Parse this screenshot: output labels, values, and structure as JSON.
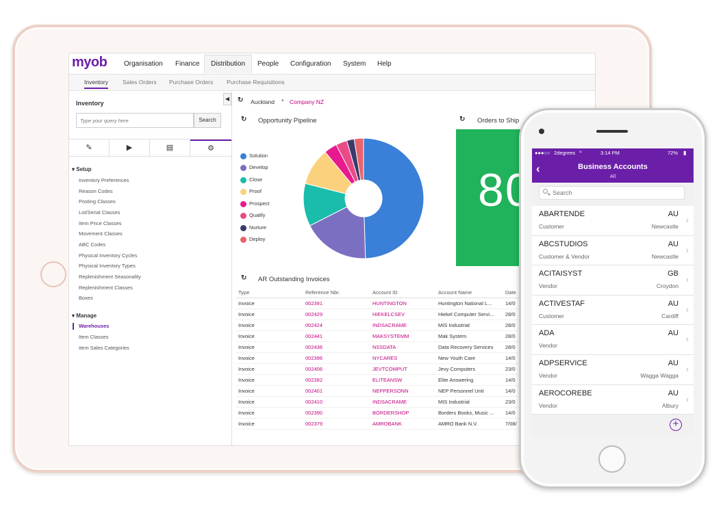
{
  "app": {
    "logo": "myob",
    "nav": [
      "Organisation",
      "Finance",
      "Distribution",
      "People",
      "Configuration",
      "System",
      "Help"
    ],
    "active_nav": "Distribution",
    "subtabs": [
      "Inventory",
      "Sales Orders",
      "Purchase Orders",
      "Purchase Requisitions"
    ],
    "active_subtab": "Inventory"
  },
  "sidebar": {
    "title": "Inventory",
    "search_placeholder": "Type your query here",
    "search_button": "Search",
    "tools": [
      "pencil-icon",
      "play-icon",
      "report-icon",
      "gear-icon"
    ],
    "setup_heading": "Setup",
    "setup_items": [
      "Inventory Preferences",
      "Reason Codes",
      "Posting Classes",
      "Lot/Serial Classes",
      "Item Price Classes",
      "Movement Classes",
      "ABC Codes",
      "Physical Inventory Cycles",
      "Physical Inventory Types",
      "Replenishment Seasonality",
      "Replenishment Classes",
      "Boxes"
    ],
    "manage_heading": "Manage",
    "manage_items": [
      "Warehouses",
      "Item Classes",
      "Item Sales Categories"
    ],
    "selected_item": "Warehouses"
  },
  "context": {
    "branch": "Auckland",
    "company": "Company NZ"
  },
  "pipeline": {
    "title": "Opportunity Pipeline",
    "legend": [
      {
        "name": "Solution",
        "color": "#3a7fd8"
      },
      {
        "name": "Develop",
        "color": "#7b6fc2"
      },
      {
        "name": "Close",
        "color": "#1abcab"
      },
      {
        "name": "Proof",
        "color": "#fcd17d"
      },
      {
        "name": "Prospect",
        "color": "#e81a8d"
      },
      {
        "name": "Qualify",
        "color": "#e94b86"
      },
      {
        "name": "Nurture",
        "color": "#3b3a6e"
      },
      {
        "name": "Deploy",
        "color": "#e8646d"
      }
    ]
  },
  "chart_data": {
    "type": "pie",
    "categories": [
      "Solution",
      "Develop",
      "Close",
      "Proof",
      "Prospect",
      "Qualify",
      "Nurture",
      "Deploy"
    ],
    "values": [
      49.5,
      18,
      11.5,
      10,
      3.5,
      3,
      2,
      2.5
    ],
    "colors": [
      "#3a7fd8",
      "#7b6fc2",
      "#1abcab",
      "#fcd17d",
      "#e81a8d",
      "#e94b86",
      "#3b3a6e",
      "#e8646d"
    ],
    "title": "Opportunity Pipeline",
    "legend_position": "left"
  },
  "orders_widget": {
    "title": "Orders to Ship",
    "value": "80"
  },
  "invoices": {
    "title": "AR Outstanding Invoices",
    "columns": [
      "Type",
      "Reference Nbr.",
      "Account ID",
      "Account Name",
      "Date"
    ],
    "rows": [
      [
        "Invoice",
        "002391",
        "HUNTINGTON",
        "Huntington National L...",
        "14/0"
      ],
      [
        "Invoice",
        "002429",
        "HIEKELCSEV",
        "Hiekel Computer Servi...",
        "28/0"
      ],
      [
        "Invoice",
        "002424",
        "INDSACRAME",
        "MIS Industrial",
        "28/0"
      ],
      [
        "Invoice",
        "002441",
        "MAKSYSTEMM",
        "Mak System",
        "28/0"
      ],
      [
        "Invoice",
        "002436",
        "NSSDATA",
        "Data Recovery Services",
        "28/0"
      ],
      [
        "Invoice",
        "002396",
        "NYCARES",
        "New Youth Care",
        "14/0"
      ],
      [
        "Invoice",
        "002406",
        "JEVTCOMPUT",
        "Jevy Computers",
        "23/0"
      ],
      [
        "Invoice",
        "002392",
        "ELITEANSW",
        "Elite Answering",
        "14/0"
      ],
      [
        "Invoice",
        "002401",
        "NEPPERSONN",
        "NEP Personnel Unit",
        "14/0"
      ],
      [
        "Invoice",
        "002410",
        "INDSACRAME",
        "MIS Industrial",
        "23/0"
      ],
      [
        "Invoice",
        "002390",
        "BORDERSHOP",
        "Borders Books, Music ...",
        "14/0"
      ],
      [
        "Invoice",
        "002379",
        "AMROBANK",
        "AMRO Bank N.V.",
        "7/08/"
      ]
    ]
  },
  "phone": {
    "carrier": "2degrees",
    "time": "3:14 PM",
    "battery": "72%",
    "title": "Business Accounts",
    "subtitle": "All",
    "search_placeholder": "Search",
    "accounts": [
      {
        "code": "ABARTENDE",
        "type": "Customer",
        "country": "AU",
        "city": "Newcastle"
      },
      {
        "code": "ABCSTUDIOS",
        "type": "Customer & Vendor",
        "country": "AU",
        "city": "Newcastle"
      },
      {
        "code": "ACITAISYST",
        "type": "Vendor",
        "country": "GB",
        "city": "Croydon"
      },
      {
        "code": "ACTIVESTAF",
        "type": "Customer",
        "country": "AU",
        "city": "Cardiff"
      },
      {
        "code": "ADA",
        "type": "Vendor",
        "country": "AU",
        "city": ""
      },
      {
        "code": "ADPSERVICE",
        "type": "Vendor",
        "country": "AU",
        "city": "Wagga Wagga"
      },
      {
        "code": "AEROCOREBE",
        "type": "Vendor",
        "country": "AU",
        "city": "Albury"
      }
    ]
  }
}
